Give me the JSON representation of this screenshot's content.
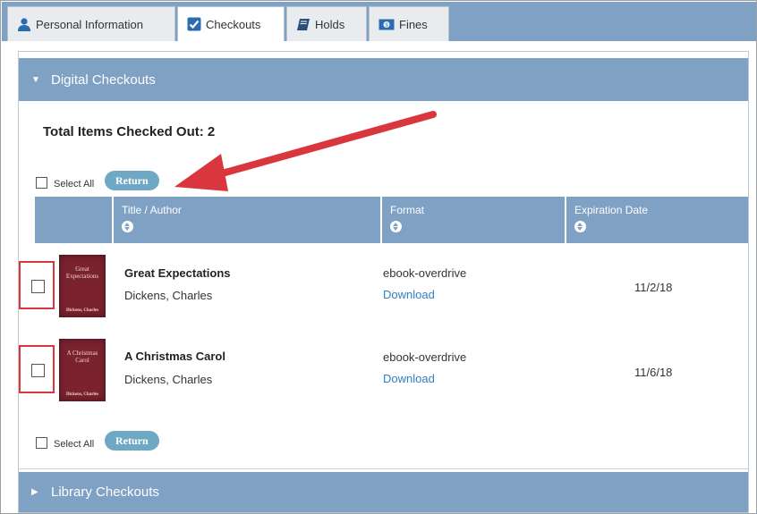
{
  "tabs": [
    {
      "label": "Personal Information",
      "icon": "person-icon",
      "active": false
    },
    {
      "label": "Checkouts",
      "icon": "checkbox-icon",
      "active": true
    },
    {
      "label": "Holds",
      "icon": "book-icon",
      "active": false
    },
    {
      "label": "Fines",
      "icon": "money-icon",
      "active": false
    }
  ],
  "digital": {
    "header": "Digital Checkouts",
    "total_label": "Total Items Checked Out: 2",
    "select_all_label": "Select All",
    "return_label": "Return",
    "columns": [
      "Title / Author",
      "Format",
      "Expiration Date"
    ],
    "items": [
      {
        "title": "Great Expectations",
        "author": "Dickens, Charles",
        "format": "ebook-overdrive",
        "action": "Download",
        "expiration": "11/2/18",
        "cover_title": "Great Expectations",
        "cover_author": "Dickens, Charles"
      },
      {
        "title": "A Christmas Carol",
        "author": "Dickens, Charles",
        "format": "ebook-overdrive",
        "action": "Download",
        "expiration": "11/6/18",
        "cover_title": "A Christmas Carol",
        "cover_author": "Dickens, Charles"
      }
    ]
  },
  "library": {
    "header": "Library Checkouts"
  },
  "colors": {
    "accent": "#7fa1c4",
    "button": "#6fa8c4",
    "link": "#2f7fc1",
    "annotation": "#d9363e",
    "cover": "#7a2230"
  }
}
